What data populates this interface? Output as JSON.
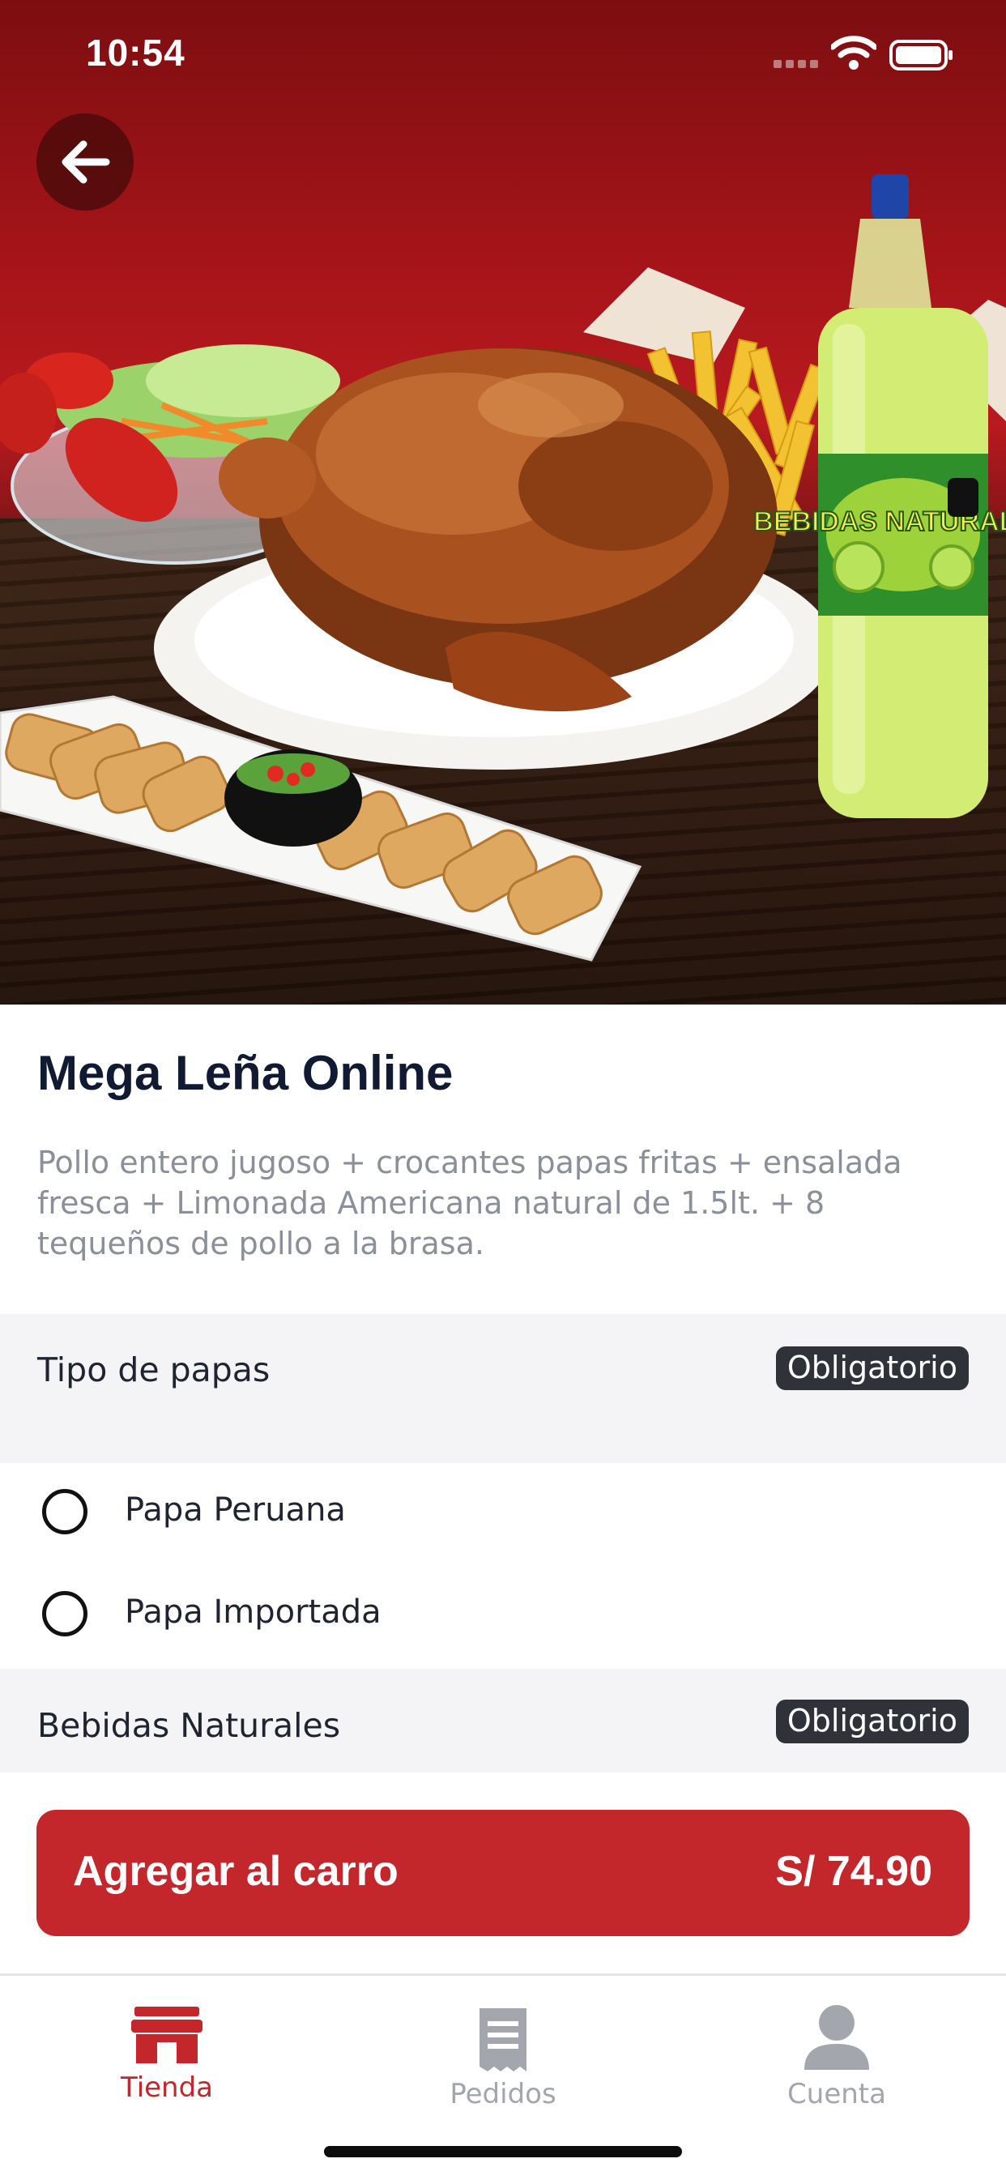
{
  "status_bar": {
    "time": "10:54"
  },
  "product": {
    "name": "Mega Leña Online",
    "description": "Pollo entero jugoso + crocantes papas fritas + ensalada fresca + Limonada Americana natural de 1.5lt. + 8 tequeños de pollo a la brasa.",
    "bottle_label": "BEBIDAS NATURALES"
  },
  "option_groups": [
    {
      "title": "Tipo de papas",
      "badge": "Obligatorio",
      "options": [
        {
          "label": "Papa Peruana",
          "selected": false
        },
        {
          "label": "Papa Importada",
          "selected": false
        }
      ]
    },
    {
      "title": "Bebidas Naturales",
      "badge": "Obligatorio",
      "options": []
    }
  ],
  "cart": {
    "label": "Agregar al carro",
    "price": "S/ 74.90"
  },
  "tabs": [
    {
      "label": "Tienda",
      "icon": "store-icon",
      "active": true
    },
    {
      "label": "Pedidos",
      "icon": "receipt-icon",
      "active": false
    },
    {
      "label": "Cuenta",
      "icon": "user-icon",
      "active": false
    }
  ],
  "colors": {
    "brand_red": "#c3262b",
    "badge_bg": "#2f3238",
    "inactive_tab": "#a3a6ad",
    "title_navy": "#111a33"
  }
}
